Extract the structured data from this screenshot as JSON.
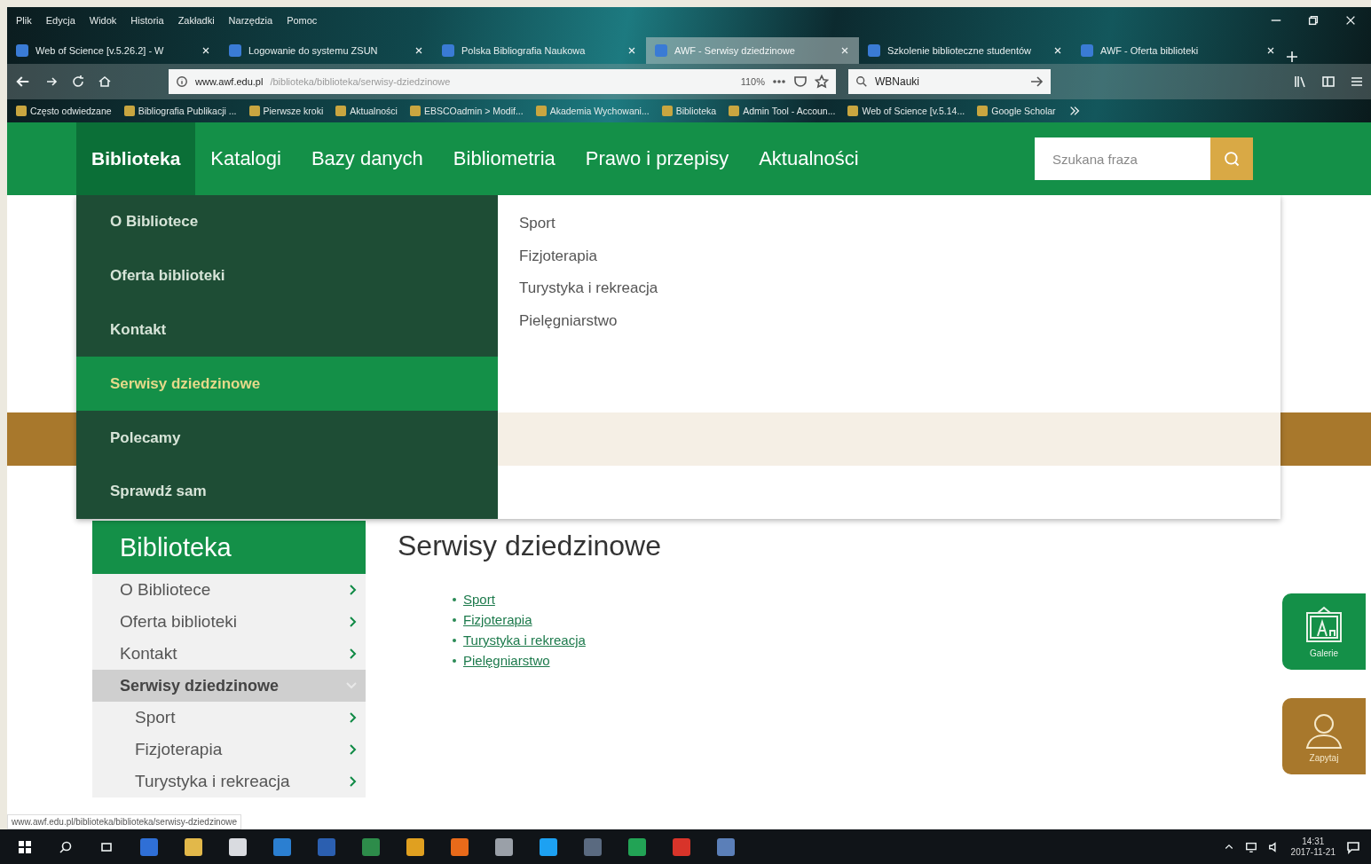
{
  "menu_bar": [
    "Plik",
    "Edycja",
    "Widok",
    "Historia",
    "Zakładki",
    "Narzędzia",
    "Pomoc"
  ],
  "tabs": [
    {
      "title": "Web of Science [v.5.26.2] - W",
      "selected": false
    },
    {
      "title": "Logowanie do systemu ZSUN",
      "selected": false
    },
    {
      "title": "Polska Bibliografia Naukowa",
      "selected": false
    },
    {
      "title": "AWF - Serwisy dziedzinowe",
      "selected": true
    },
    {
      "title": "Szkolenie biblioteczne studentów",
      "selected": false
    },
    {
      "title": "AWF - Oferta biblioteki",
      "selected": false
    }
  ],
  "address_bar": {
    "host": "www.awf.edu.pl",
    "path": "/biblioteka/biblioteka/serwisy-dziedzinowe",
    "zoom": "110%"
  },
  "browser_search": {
    "value": "WBNauki"
  },
  "bookmarks": [
    "Często odwiedzane",
    "Bibliografia Publikacji ...",
    "Pierwsze kroki",
    "Aktualności",
    "EBSCOadmin > Modif...",
    "Akademia Wychowani...",
    "Biblioteka",
    "Admin Tool - Accoun...",
    "Web of Science [v.5.14...",
    "Google Scholar"
  ],
  "site_nav": {
    "items": [
      {
        "label": "Biblioteka",
        "selected": true
      },
      {
        "label": "Katalogi",
        "selected": false
      },
      {
        "label": "Bazy danych",
        "selected": false
      },
      {
        "label": "Bibliometria",
        "selected": false
      },
      {
        "label": "Prawo i przepisy",
        "selected": false
      },
      {
        "label": "Aktualności",
        "selected": false
      }
    ],
    "search_placeholder": "Szukana fraza"
  },
  "dropdown": {
    "items": [
      {
        "label": "O Bibliotece",
        "selected": false
      },
      {
        "label": "Oferta biblioteki",
        "selected": false
      },
      {
        "label": "Kontakt",
        "selected": false
      },
      {
        "label": "Serwisy dziedzinowe",
        "selected": true
      },
      {
        "label": "Polecamy",
        "selected": false
      },
      {
        "label": "Sprawdź sam",
        "selected": false
      }
    ],
    "subitems": [
      "Sport",
      "Fizjoterapia",
      "Turystyka i rekreacja",
      "Pielęgniarstwo"
    ]
  },
  "sidebar": {
    "title": "Biblioteka",
    "items": [
      {
        "label": "O Bibliotece",
        "selected": false,
        "expanded": false
      },
      {
        "label": "Oferta biblioteki",
        "selected": false,
        "expanded": false
      },
      {
        "label": "Kontakt",
        "selected": false,
        "expanded": false
      },
      {
        "label": "Serwisy dziedzinowe",
        "selected": true,
        "expanded": true,
        "children": [
          {
            "label": "Sport",
            "selected": false,
            "expanded": false
          },
          {
            "label": "Fizjoterapia",
            "selected": false,
            "expanded": false
          },
          {
            "label": "Turystyka i rekreacja",
            "selected": false,
            "expanded": false
          }
        ]
      }
    ]
  },
  "content": {
    "title": "Serwisy dziedzinowe",
    "links": [
      "Sport",
      "Fizjoterapia",
      "Turystyka i rekreacja",
      "Pielęgniarstwo"
    ]
  },
  "side_buttons": [
    {
      "label": "Galerie",
      "kind": "gallery"
    },
    {
      "label": "Zapytaj",
      "kind": "ask"
    }
  ],
  "status_url": "www.awf.edu.pl/biblioteka/biblioteka/serwisy-dziedzinowe",
  "taskbar": {
    "time": "14:31",
    "date": "2017-11-21"
  }
}
